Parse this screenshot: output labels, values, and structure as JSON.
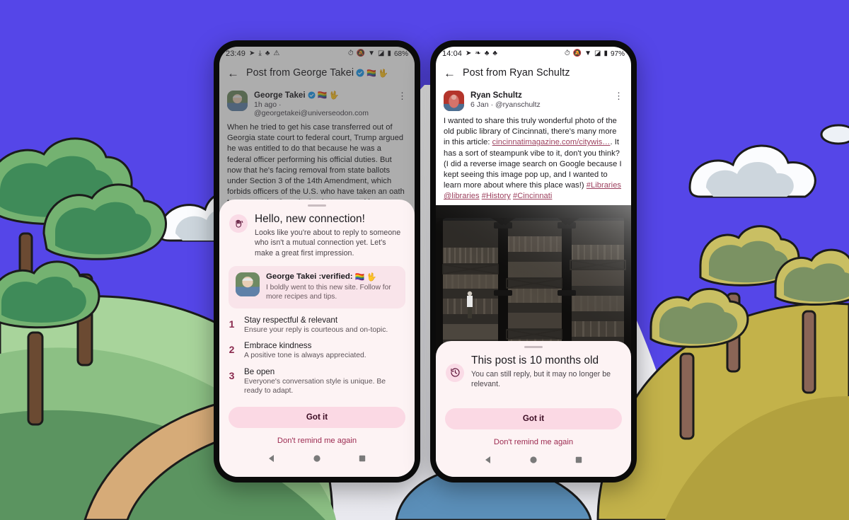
{
  "background": {
    "name": "cartoon-landscape-wallpaper",
    "sky_color": "#5546e8",
    "hill_left_color": "#5b9460",
    "hill_left_light": "#a8d49b",
    "hill_right_color": "#c3b24a",
    "path_color": "#d6ab78",
    "tree_green": "#4f8f5f",
    "tree_olive": "#c9bf63",
    "cloud_color": "#ffffff",
    "water_color": "#5b8fb9"
  },
  "phones": [
    {
      "id": "left",
      "status_bar": {
        "time": "23:49",
        "battery": "68%",
        "left_icons": [
          "telegram-icon",
          "download-icon",
          "mastodon-icon",
          "warning-icon"
        ],
        "right_icons": [
          "alarm-icon",
          "notifications-off-icon",
          "wifi-icon",
          "signal-icon",
          "battery-icon"
        ]
      },
      "app_bar": {
        "back_label": "←",
        "title": "Post from George Takei",
        "title_badges": [
          "verified-check",
          "🏳️‍🌈",
          "🖖"
        ]
      },
      "post": {
        "author_name": "George Takei",
        "author_badges": [
          "verified-check",
          "🏳️‍🌈",
          "🖖"
        ],
        "meta": "1h ago · @georgetakei@universeodon.com",
        "body": "When he tried to get his case transferred out of Georgia state court to federal court, Trump argued he was entitled to do that because he was a federal officer performing his official duties. But now that he's facing removal from state ballots under Section 3 of the 14th Amendment, which forbids officers of the U.S. who have taken an oath to support the Constitution but engaged in insurrection from holding federal public office, he's claiming he's not an officer."
      },
      "sheet": {
        "icon": "waving-hand-icon",
        "title": "Hello, new connection!",
        "subtitle": "Looks like you're about to reply to someone who isn't a mutual connection yet. Let's make a great first impression.",
        "profile_card": {
          "name": "George Takei :verified:",
          "name_emoji": [
            "🏳️‍🌈",
            "🖖"
          ],
          "bio": "I boldly went to this new site. Follow for more recipes and tips."
        },
        "tips": [
          {
            "num": "1",
            "title": "Stay respectful & relevant",
            "desc": "Ensure your reply is courteous and on-topic."
          },
          {
            "num": "2",
            "title": "Embrace kindness",
            "desc": "A positive tone is always appreciated."
          },
          {
            "num": "3",
            "title": "Be open",
            "desc": "Everyone's conversation style is unique. Be ready to adapt."
          }
        ],
        "primary_button": "Got it",
        "secondary_button": "Don't remind me again"
      },
      "nav_bar": {
        "back": "back-triangle-icon",
        "home": "home-circle-icon",
        "recents": "recents-square-icon"
      }
    },
    {
      "id": "right",
      "status_bar": {
        "time": "14:04",
        "battery": "97%",
        "left_icons": [
          "telegram-icon",
          "mastodon-alt-icon",
          "mastodon-icon",
          "mastodon-icon"
        ],
        "right_icons": [
          "alarm-icon",
          "notifications-off-icon",
          "wifi-icon",
          "signal-icon",
          "battery-icon"
        ]
      },
      "app_bar": {
        "back_label": "←",
        "title": "Post from Ryan Schultz",
        "title_badges": []
      },
      "post": {
        "author_name": "Ryan Schultz",
        "author_badges": [],
        "meta": "6 Jan · @ryanschultz",
        "body_part1": "I wanted to share this truly wonderful photo of the old public library of Cincinnati, there's many more in this article: ",
        "body_link": "cincinnatimagazine.com/citywis…",
        "body_part2": ". It has a sort of steampunk vibe to it, don't you think? (I did a reverse image search on Google because I kept seeing this image pop up, and I wanted to learn more about where this place was!) ",
        "hashtags": [
          "#Libraries",
          "@libraries",
          "#History",
          "#Cincinnati"
        ],
        "image_alt": "black-and-white-photo-old-cincinnati-public-library"
      },
      "sheet": {
        "icon": "history-clock-icon",
        "title": "This post is 10 months old",
        "subtitle": "You can still reply, but it may no longer be relevant.",
        "primary_button": "Got it",
        "secondary_button": "Don't remind me again"
      },
      "nav_bar": {
        "back": "back-triangle-icon",
        "home": "home-circle-icon",
        "recents": "recents-square-icon"
      }
    }
  ]
}
